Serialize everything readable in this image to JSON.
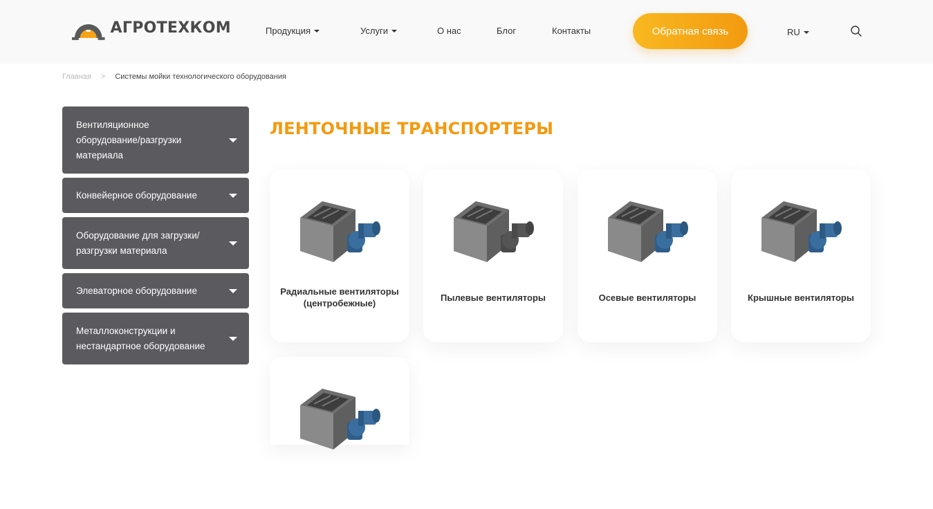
{
  "header": {
    "brand": "АГРОТЕХКОМ",
    "nav": [
      {
        "label": "Продукция",
        "has_caret": true
      },
      {
        "label": "Услуги",
        "has_caret": true
      },
      {
        "label": "О нас",
        "has_caret": false
      },
      {
        "label": "Блог",
        "has_caret": false
      },
      {
        "label": "Контакты",
        "has_caret": false
      }
    ],
    "cta_label": "Обратная связь",
    "lang": "RU",
    "search_icon": "search-icon"
  },
  "breadcrumb": {
    "home": "Главная",
    "separator": ">",
    "current": "Системы мойки технологического оборудования"
  },
  "sidebar": {
    "items": [
      {
        "label": "Вентиляционное оборудование/разгрузки материала"
      },
      {
        "label": "Конвейерное оборудование"
      },
      {
        "label": "Оборудование для загрузки/разгрузки материала"
      },
      {
        "label": "Элеваторное оборудование"
      },
      {
        "label": "Металлоконструкции и нестандартное оборудование"
      }
    ]
  },
  "main": {
    "title": "ЛЕНТОЧНЫЕ ТРАНСПОРТЕРЫ",
    "cards": [
      {
        "label": "Радиальные вентиляторы (центробежные)"
      },
      {
        "label": "Пылевые вентиляторы"
      },
      {
        "label": "Осевые вентиляторы"
      },
      {
        "label": "Крышные вентиляторы"
      },
      {
        "label": ""
      }
    ]
  },
  "colors": {
    "accent": "#f39a10",
    "cta_start": "#f8b820",
    "sidebar_bg": "#5b5b5f",
    "header_bg": "#f9f9f9"
  }
}
